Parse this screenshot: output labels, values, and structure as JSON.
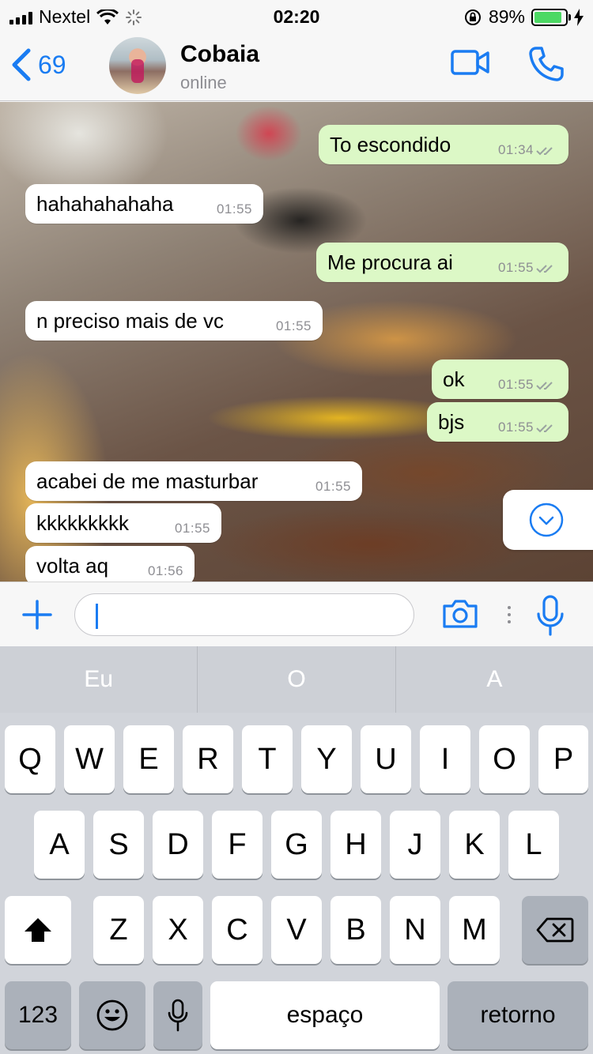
{
  "status_bar": {
    "carrier": "Nextel",
    "time": "02:20",
    "battery_percent": "89%",
    "battery_level": 0.89,
    "battery_color": "#4cd964"
  },
  "header": {
    "back_count": "69",
    "contact_name": "Cobaia",
    "contact_status": "online",
    "icons": [
      "back-chevron-icon",
      "video-call-icon",
      "phone-call-icon"
    ],
    "accent_color": "#1a7cf2"
  },
  "messages": [
    {
      "direction": "out",
      "text": "To escondido",
      "time": "01:34"
    },
    {
      "direction": "in",
      "text": "hahahahahaha",
      "time": "01:55"
    },
    {
      "direction": "out",
      "text": "Me procura ai",
      "time": "01:55"
    },
    {
      "direction": "in",
      "text": "n preciso mais de vc",
      "time": "01:55"
    },
    {
      "direction": "out",
      "text": "ok",
      "time": "01:55"
    },
    {
      "direction": "out",
      "text": "bjs",
      "time": "01:55"
    },
    {
      "direction": "in",
      "text": "acabei de me masturbar",
      "time": "01:55"
    },
    {
      "direction": "in",
      "text": "kkkkkkkkk",
      "time": "01:55"
    },
    {
      "direction": "in",
      "text": "volta aq",
      "time": "01:56"
    }
  ],
  "bubble_colors": {
    "incoming": "#ffffff",
    "outgoing": "#dcf8c6"
  },
  "input_bar": {
    "message_value": "",
    "icons": [
      "plus-icon",
      "camera-icon",
      "more-dots-icon",
      "microphone-icon"
    ]
  },
  "suggestions": [
    "Eu",
    "O",
    "A"
  ],
  "keyboard": {
    "row1": [
      "Q",
      "W",
      "E",
      "R",
      "T",
      "Y",
      "U",
      "I",
      "O",
      "P"
    ],
    "row2": [
      "A",
      "S",
      "D",
      "F",
      "G",
      "H",
      "J",
      "K",
      "L"
    ],
    "row3": [
      "Z",
      "X",
      "C",
      "V",
      "B",
      "N",
      "M"
    ],
    "numbers_key": "123",
    "space_key": "espaço",
    "return_key": "retorno",
    "icons": [
      "shift-icon",
      "backspace-icon",
      "emoji-icon",
      "dictation-mic-icon"
    ]
  }
}
